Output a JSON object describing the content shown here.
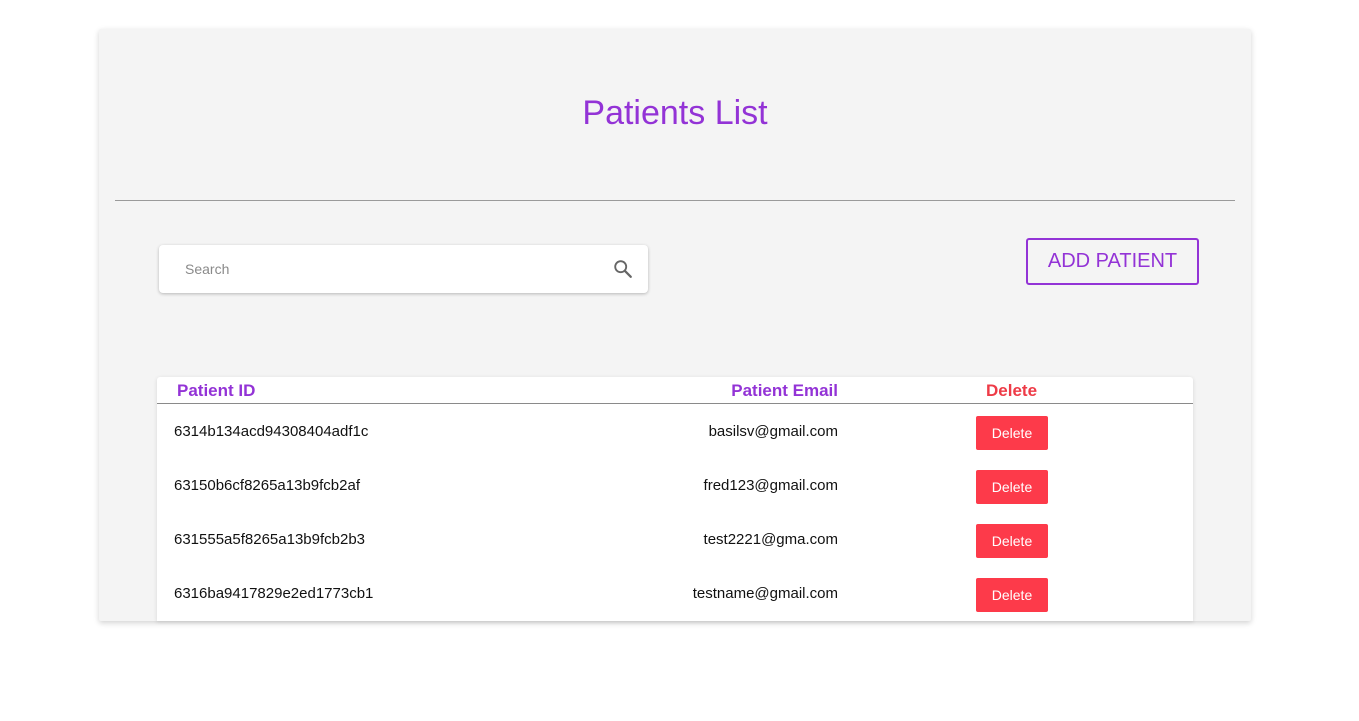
{
  "page": {
    "title": "Patients List"
  },
  "search": {
    "placeholder": "Search",
    "value": "",
    "icon": "search-icon"
  },
  "toolbar": {
    "add_label": "ADD PATIENT"
  },
  "table": {
    "headers": {
      "id": "Patient ID",
      "email": "Patient Email",
      "delete": "Delete"
    },
    "rows": [
      {
        "id": "6314b134acd94308404adf1c",
        "email": "basilsv@gmail.com",
        "action": "Delete"
      },
      {
        "id": "63150b6cf8265a13b9fcb2af",
        "email": "fred123@gmail.com",
        "action": "Delete"
      },
      {
        "id": "631555a5f8265a13b9fcb2b3",
        "email": "test2221@gma.com",
        "action": "Delete"
      },
      {
        "id": "6316ba9417829e2ed1773cb1",
        "email": "testname@gmail.com",
        "action": "Delete"
      }
    ]
  },
  "colors": {
    "accent": "#9333d6",
    "danger": "#fd3a4a",
    "card_bg": "#f4f4f4"
  }
}
